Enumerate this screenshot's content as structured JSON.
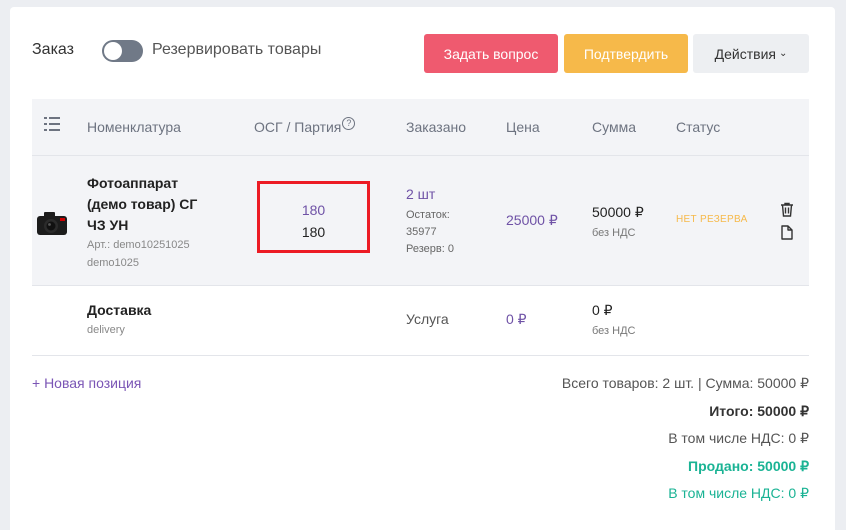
{
  "header": {
    "order_label": "Заказ",
    "reserve_label": "Резервировать товары",
    "reserve_toggle_on": false,
    "ask_button": "Задать вопрос",
    "confirm_button": "Подтвердить",
    "actions_button": "Действия",
    "colors": {
      "ask": "#ef5a6f",
      "confirm": "#f6b94a"
    }
  },
  "table": {
    "columns": [
      "Номенклатура",
      "ОСГ / Партия",
      "Заказано",
      "Цена",
      "Сумма",
      "Статус"
    ],
    "help_glyph": "?",
    "rows": [
      {
        "name": "Фотоаппарат (демо товар) СГ ЧЗ УН",
        "sku": "Арт.: demo10251025",
        "code": "demo1025",
        "osg_1": "180",
        "osg_2": "180",
        "ordered": "2 шт",
        "rest_label": "Остаток:",
        "rest_value": "35977",
        "reserve": "Резерв: 0",
        "price": "25000 ₽",
        "sum": "50000 ₽",
        "vat": "без НДС",
        "status": "НЕТ РЕЗЕРВА"
      },
      {
        "name": "Доставка",
        "code": "delivery",
        "ordered": "Услуга",
        "price": "0 ₽",
        "sum": "0 ₽",
        "vat": "без НДС"
      }
    ]
  },
  "footer": {
    "add_position": "+ Новая позиция",
    "totals": "Всего товаров: 2 шт. | Сумма: 50000 ₽",
    "total": "Итого: 50000 ₽",
    "vat_included": "В том числе НДС: 0 ₽",
    "sold": "Продано: 50000 ₽",
    "sold_vat": "В том числе НДС: 0 ₽"
  }
}
